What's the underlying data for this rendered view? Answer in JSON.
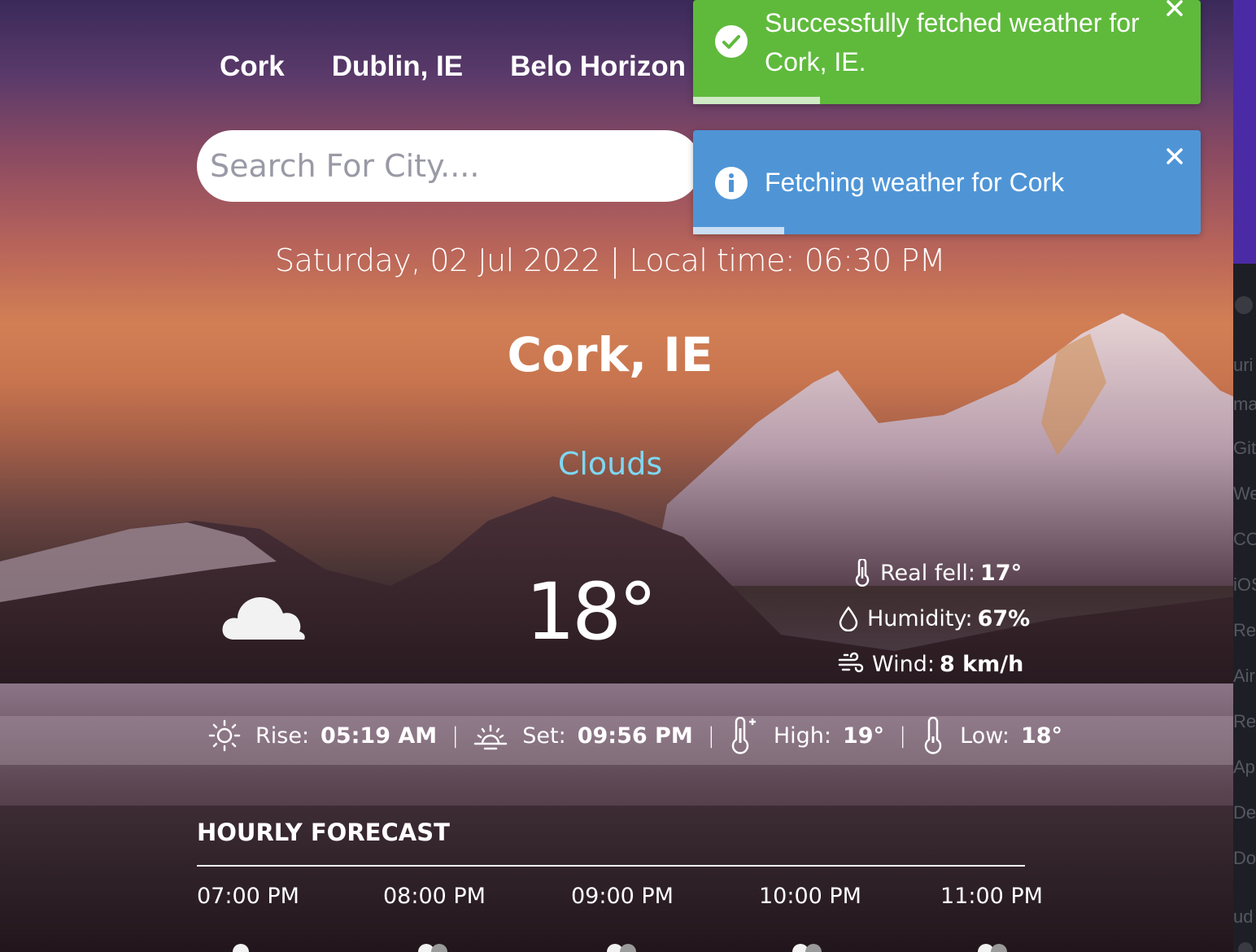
{
  "nav": {
    "links": [
      "Cork",
      "Dublin, IE",
      "Belo Horizon"
    ]
  },
  "search": {
    "placeholder": "Search For City...."
  },
  "datetime": "Saturday, 02 Jul 2022 | Local time: 06:30 PM",
  "city": "Cork, IE",
  "condition": "Clouds",
  "condition_color": "#7fd7f2",
  "weather_icon": "cloud-icon",
  "temperature": "18°",
  "details": {
    "real_feel_label": "Real fell:",
    "real_feel_value": "17°",
    "humidity_label": "Humidity:",
    "humidity_value": "67%",
    "wind_label": "Wind:",
    "wind_value": "8 km/h"
  },
  "sun": {
    "rise_label": "Rise:",
    "rise_value": "05:19 AM",
    "set_label": "Set:",
    "set_value": "09:56 PM",
    "high_label": "High:",
    "high_value": "19°",
    "low_label": "Low:",
    "low_value": "18°",
    "separator": "|"
  },
  "hourly": {
    "title": "HOURLY FORECAST",
    "items": [
      {
        "time": "07:00 PM"
      },
      {
        "time": "08:00 PM"
      },
      {
        "time": "09:00 PM"
      },
      {
        "time": "10:00 PM"
      },
      {
        "time": "11:00 PM"
      }
    ]
  },
  "toasts": {
    "success": {
      "message": "Successfully fetched weather for Cork, IE.",
      "color": "#5fba3c",
      "progress": 0.25
    },
    "info": {
      "message": "Fetching weather for Cork",
      "color": "#4f95d6",
      "progress": 0.18
    }
  },
  "sidebar_fragments": [
    "uri",
    "ma",
    "Git",
    "We",
    "CO",
    "iOS",
    "Re",
    "Air",
    "Re",
    "Ap",
    "De",
    "Do",
    "ud"
  ]
}
